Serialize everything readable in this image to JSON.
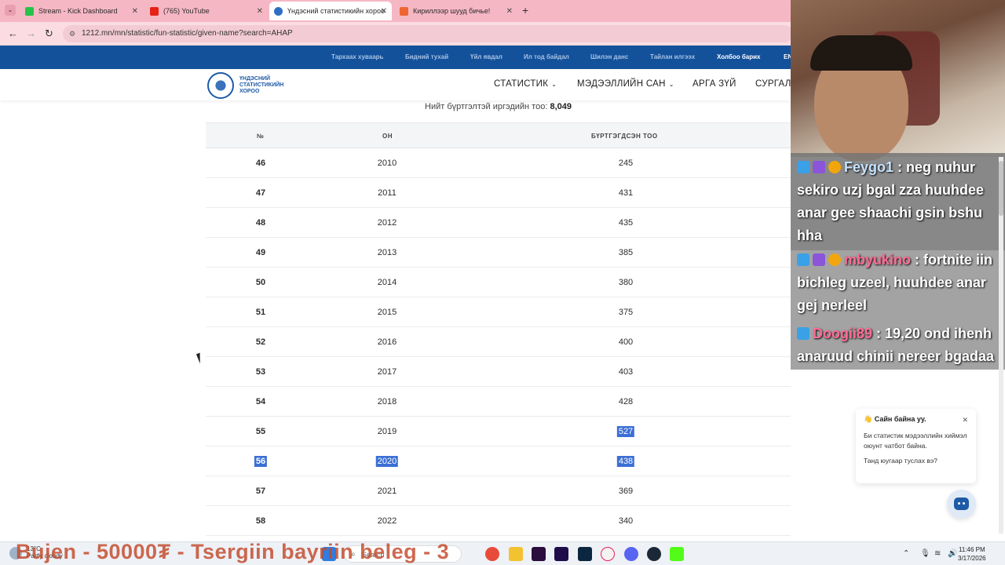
{
  "browser": {
    "tabs": [
      {
        "label": "Stream - Kick Dashboard",
        "favicon_color": "#26c34b"
      },
      {
        "label": "(765) YouTube",
        "favicon_color": "#e62117"
      },
      {
        "label": "Үндэсний статистикийн хороо",
        "favicon_color": "#2e6fc6"
      },
      {
        "label": "Кириллээр шууд бичье!",
        "favicon_color": "#ee6633"
      }
    ],
    "new_tab": "+",
    "close_glyph": "✕",
    "url": "1212.mn/mn/statistic/fun-statistic/given-name?search=АНАР"
  },
  "site": {
    "topnav": [
      "Тархаах хуваарь",
      "Бидний тухай",
      "Үйл явдал",
      "Ил тод байдал",
      "Шилэн данс",
      "Тайлан илгээх",
      "Холбоо барих",
      "EN"
    ],
    "logo_text": "ҮНДЭСНИЙ СТАТИСТИКИЙН ХОРОО",
    "mainnav": [
      {
        "label": "СТАТИСТИК",
        "chevron": "⌄"
      },
      {
        "label": "МЭДЭЭЛЛИЙН САН",
        "chevron": "⌄"
      },
      {
        "label": "АРГА ЗҮЙ",
        "chevron": ""
      },
      {
        "label": "СУРГАЛТ",
        "chevron": ""
      }
    ],
    "summary_label": "Нийт бүртгэлтэй иргэдийн тоо:",
    "summary_value": "8,049"
  },
  "table": {
    "headers": [
      "№",
      "ОН",
      "БҮРТГЭГДСЭН ТОО"
    ],
    "rows": [
      {
        "n": "46",
        "year": "2010",
        "count": "245"
      },
      {
        "n": "47",
        "year": "2011",
        "count": "431"
      },
      {
        "n": "48",
        "year": "2012",
        "count": "435"
      },
      {
        "n": "49",
        "year": "2013",
        "count": "385"
      },
      {
        "n": "50",
        "year": "2014",
        "count": "380"
      },
      {
        "n": "51",
        "year": "2015",
        "count": "375"
      },
      {
        "n": "52",
        "year": "2016",
        "count": "400"
      },
      {
        "n": "53",
        "year": "2017",
        "count": "403"
      },
      {
        "n": "54",
        "year": "2018",
        "count": "428"
      },
      {
        "n": "55",
        "year": "2019",
        "count": "527"
      },
      {
        "n": "56",
        "year": "2020",
        "count": "438"
      },
      {
        "n": "57",
        "year": "2021",
        "count": "369"
      },
      {
        "n": "58",
        "year": "2022",
        "count": "340"
      }
    ],
    "selection_color": "#3b6fd4"
  },
  "chat": {
    "messages": [
      {
        "user": "Feygo1",
        "text": "neg nuhur sekiro uzj bgal zza huuhdee anar gee shaachi gsin bshu hha",
        "user_color": "#c5e3ff"
      },
      {
        "user": "mbyukino",
        "text": "fortnite iin bichleg uzeel, huuhdee anar gej nerleel",
        "user_color": "#ff6b96"
      },
      {
        "user": "Doogii89",
        "text": "19,20 ond ihenh anaruud chinii nereer bgadaa",
        "user_color": "#ff6b96"
      }
    ]
  },
  "chatbot": {
    "title": "Сайн байна уу.",
    "wave": "👋",
    "line1": "Би статистик мэдээллийн хиймэл оюунт чатбот байна.",
    "line2": "Танд юугаар туслах вэ?",
    "close": "✕"
  },
  "taskbar": {
    "temperature": "13°C",
    "weather": "Partly cloudy",
    "search_placeholder": "Search",
    "time": "11:46 PM",
    "date": "3/17/2026"
  },
  "overlay_ticker": "Bujen - 50000₮ - Tsergiin bayriin beleg - 3"
}
